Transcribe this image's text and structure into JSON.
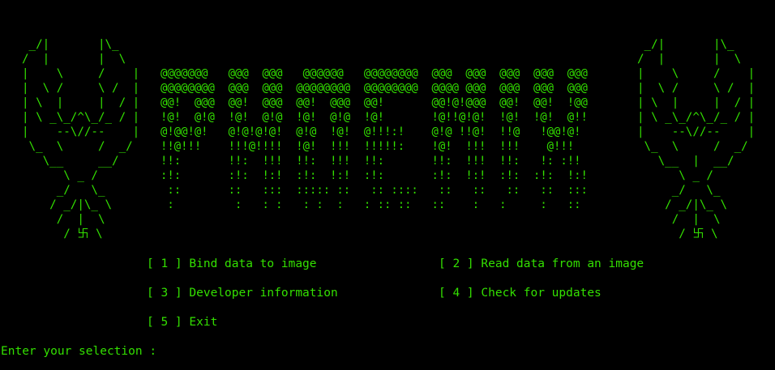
{
  "theme": {
    "background": "#000000",
    "foreground": "#33e000"
  },
  "art": {
    "left_emblem": " _/|       |\\_\n/  |       |  \\\n|    \\     /    |\n|  \\ /     \\ /  |\n| \\  |     |  / |\n| \\ _\\_/^\\_/_ / |\n|    --\\//--    |\n \\_  \\     /  _/\n   \\__     __/\n      \\ _ /\n     _/   \\_\n    / _/|\\_ \\\n     /  |  \\\n      / 卐 \\",
    "title_banner": "@@@@@@@   @@@  @@@   @@@@@@   @@@@@@@@  @@@  @@@  @@@  @@@  @@@\n@@@@@@@@  @@@  @@@  @@@@@@@@  @@@@@@@@  @@@@ @@@  @@@  @@@  @@@\n@@!  @@@  @@!  @@@  @@!  @@@  @@!       @@!@!@@@  @@!  @@!  !@@\n!@!  @!@  !@!  @!@  !@!  @!@  !@!       !@!!@!@!  !@!  !@!  @!!\n@!@@!@!   @!@!@!@!  @!@  !@!  @!!!:!    @!@ !!@!  !!@   !@@!@!\n!!@!!!    !!!@!!!!  !@!  !!!  !!!!!:    !@!  !!!  !!!    @!!!\n!!:       !!:  !!!  !!:  !!!  !!:       !!:  !!!  !!:   !: :!!\n:!:       :!:  !:!  :!:  !:!  :!:       :!:  !:!  :!:  :!:  !:!\n ::       ::   :::  ::::: ::   :: ::::   ::   ::   ::   ::  :::\n :         :   : :   : :  :   : :: ::   ::    :   :     :   ::",
    "right_emblem": " _/|       |\\_\n/  |       |  \\\n|    \\     /    |\n|  \\ /     \\ /  |\n| \\  |     |  / |\n| \\ _\\_/^\\_/_ / |\n|    --\\//--    |\n \\_  \\     /  _/\n   \\__  |  __/\n      \\ _ /\n     _/   \\_\n    / _/|\\_ \\\n     /  |  \\\n      / 卐 \\"
  },
  "menu": {
    "items": [
      {
        "label": "[ 1 ] Bind data to image"
      },
      {
        "label": "[ 2 ] Read data from an image"
      },
      {
        "label": "[ 3 ] Developer information"
      },
      {
        "label": "[ 4 ] Check for updates"
      },
      {
        "label": "[ 5 ] Exit"
      }
    ]
  },
  "prompt": {
    "text": "Enter your selection : ",
    "value": ""
  }
}
